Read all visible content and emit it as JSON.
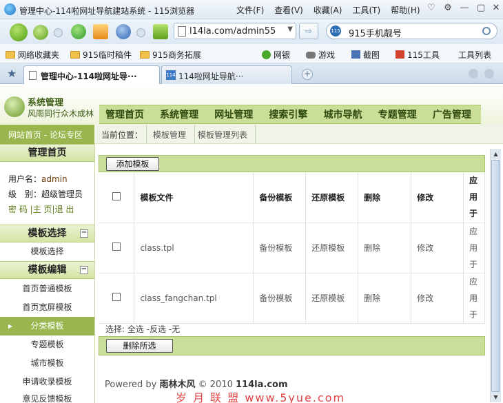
{
  "window": {
    "title": "管理中心-114啦网址导航建站系统 - 115浏览器",
    "menu": [
      "文件(F)",
      "查看(V)",
      "收藏(A)",
      "工具(T)",
      "帮助(H)"
    ]
  },
  "navbar": {
    "url": "l14la.com/admin55",
    "search_value": "915手机靓号"
  },
  "bookmarks": [
    {
      "label": "网络收藏夹",
      "icon": "folder-icon"
    },
    {
      "label": "915临时稿件",
      "icon": "folder-icon"
    },
    {
      "label": "915商务拓展",
      "icon": "folder-icon"
    },
    {
      "label": "网银",
      "icon": "bank-icon"
    },
    {
      "label": "游戏",
      "icon": "gamepad-icon"
    },
    {
      "label": "截图",
      "icon": "screenshot-icon"
    },
    {
      "label": "115工具",
      "icon": "tools-icon"
    },
    {
      "label": "工具列表",
      "icon": ""
    }
  ],
  "tabs": [
    {
      "label": "管理中心-114啦网址导···",
      "active": true
    },
    {
      "label": "114啦网址导航···",
      "active": false
    }
  ],
  "site": {
    "logo_title": "系统管理",
    "logo_slogan": "风雨同行众木成林",
    "nav": [
      "管理首页",
      "系统管理",
      "网址管理",
      "搜索引擎",
      "城市导航",
      "专题管理",
      "广告管理"
    ],
    "left_links": "网站首页 - 论坛专区",
    "breadcrumb_label": "当前位置：",
    "breadcrumb": [
      "模板管理",
      "模板管理列表"
    ]
  },
  "sidebar": {
    "home_title": "管理首页",
    "username_label": "用户名：",
    "username": "admin",
    "level_label": "级　别：",
    "level": "超级管理员",
    "links": [
      "密 码",
      "主 页",
      "退 出"
    ],
    "sections": [
      {
        "title": "模板选择",
        "toggle": "−",
        "items": [
          "模板选择"
        ]
      },
      {
        "title": "模板编辑",
        "toggle": "−",
        "items": [
          "首页普通模板",
          "首页宽屏模板",
          "分类模板",
          "专题模板",
          "城市模板",
          "申请收录模板",
          "意见反馈模板"
        ]
      }
    ],
    "selected_item": "分类模板"
  },
  "content": {
    "add_button": "添加模板",
    "headers": [
      "模板文件",
      "备份模板",
      "还原模板",
      "删除",
      "修改",
      "应用于"
    ],
    "rows": [
      {
        "file": "class.tpl",
        "backup": "备份模板",
        "restore": "还原模板",
        "delete": "删除",
        "edit": "修改",
        "apply": "应用于"
      },
      {
        "file": "class_fangchan.tpl",
        "backup": "备份模板",
        "restore": "还原模板",
        "delete": "删除",
        "edit": "修改",
        "apply": "应用于"
      }
    ],
    "select_label": "选择:",
    "select_all": "全选",
    "select_invert": "反选",
    "select_none": "无",
    "delete_all_button": "删除所选"
  },
  "footer": {
    "powered_by": "Powered by",
    "brand": "雨林木风",
    "copyright": "© 2010",
    "domain": "114la.com"
  },
  "watermark": "岁 月 联 盟  www.5yue.com",
  "colors": {
    "accent_green": "#9ab64e",
    "nav_bg": "#cbde98",
    "browser_blue": "#dde8f2",
    "watermark_red": "#e04646"
  }
}
